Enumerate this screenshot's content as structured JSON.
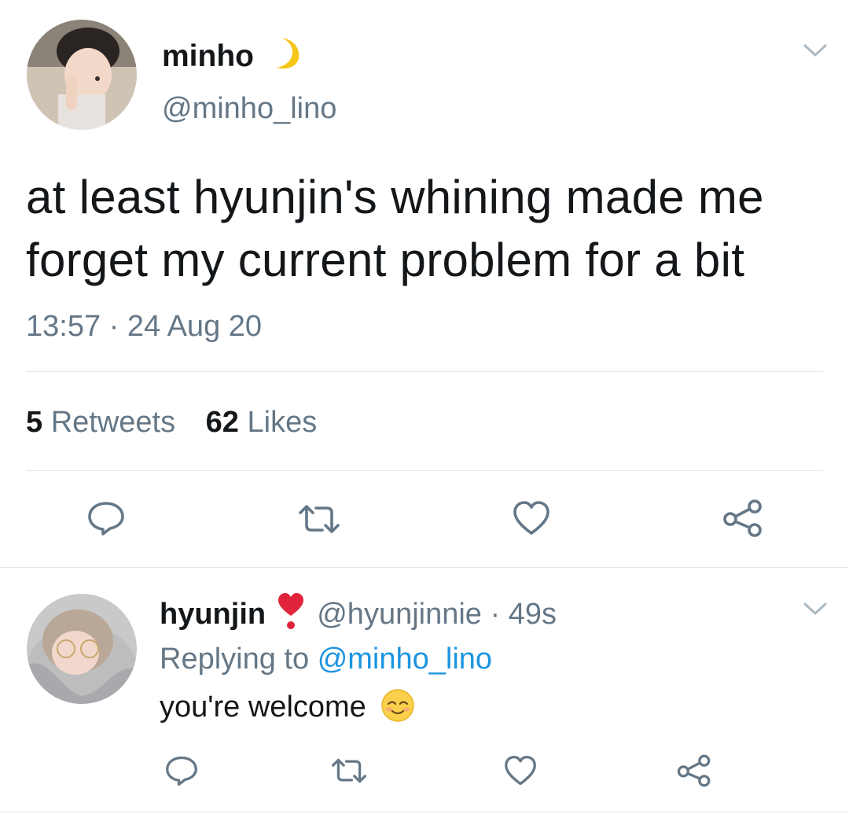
{
  "main_tweet": {
    "author": {
      "name": "minho",
      "handle": "@minho_lino",
      "name_emoji": "moon-icon"
    },
    "text_line1": "at least hyunjin's whining made me",
    "text_line2": "forget my current problem for a bit",
    "timestamp": "13:57 · 24 Aug 20",
    "stats": {
      "retweets_count": "5",
      "retweets_label": "Retweets",
      "likes_count": "62",
      "likes_label": "Likes"
    },
    "actions": [
      "reply-icon",
      "retweet-icon",
      "like-icon",
      "share-icon"
    ]
  },
  "reply_tweet": {
    "author": {
      "name": "hyunjin",
      "handle": "@hyunjinnie",
      "time": "· 49s",
      "name_emoji": "heart-exclamation-icon"
    },
    "replying_prefix": "Replying to",
    "replying_to": "@minho_lino",
    "text": "you're welcome",
    "text_emoji": "relieved-face-icon",
    "actions": [
      "reply-icon",
      "retweet-icon",
      "like-icon",
      "share-icon"
    ]
  },
  "colors": {
    "text": "#14171a",
    "muted": "#657786",
    "link": "#1b95e0",
    "icon": "#657786",
    "divider": "#e1e8ed"
  }
}
